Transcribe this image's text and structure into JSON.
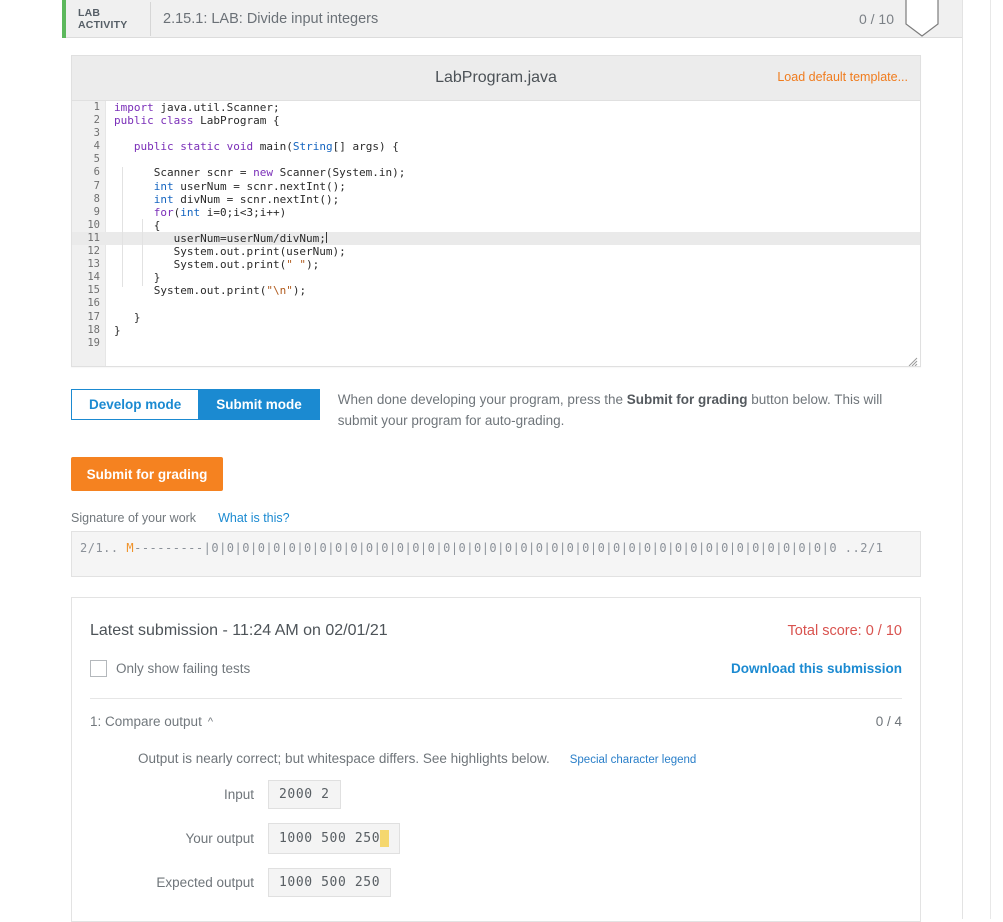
{
  "lab_header": {
    "tag_line1": "LAB",
    "tag_line2": "ACTIVITY",
    "title": "2.15.1: LAB: Divide input integers",
    "score": "0 / 10"
  },
  "editor": {
    "filename": "LabProgram.java",
    "load_default_label": "Load default template...",
    "highlight_line": 11,
    "lines": [
      {
        "no": "1",
        "code": "import java.util.Scanner;"
      },
      {
        "no": "2",
        "code": "public class LabProgram {"
      },
      {
        "no": "3",
        "code": ""
      },
      {
        "no": "4",
        "code": "   public static void main(String[] args) {"
      },
      {
        "no": "5",
        "code": ""
      },
      {
        "no": "6",
        "code": "      Scanner scnr = new Scanner(System.in);"
      },
      {
        "no": "7",
        "code": "      int userNum = scnr.nextInt();"
      },
      {
        "no": "8",
        "code": "      int divNum = scnr.nextInt();"
      },
      {
        "no": "9",
        "code": "      for(int i=0;i<3;i++)"
      },
      {
        "no": "10",
        "code": "      {"
      },
      {
        "no": "11",
        "code": "         userNum=userNum/divNum;"
      },
      {
        "no": "12",
        "code": "         System.out.print(userNum);"
      },
      {
        "no": "13",
        "code": "         System.out.print(\" \");"
      },
      {
        "no": "14",
        "code": "      }"
      },
      {
        "no": "15",
        "code": "      System.out.print(\"\\n\");"
      },
      {
        "no": "16",
        "code": ""
      },
      {
        "no": "17",
        "code": "   }"
      },
      {
        "no": "18",
        "code": "}"
      },
      {
        "no": "19",
        "code": ""
      }
    ]
  },
  "mode": {
    "develop_label": "Develop mode",
    "submit_label": "Submit mode",
    "note_prefix": "When done developing your program, press the ",
    "note_bold": "Submit for grading",
    "note_suffix": " button below. This will submit your program for auto-grading."
  },
  "submit_button": {
    "label": "Submit for grading"
  },
  "signature": {
    "label": "Signature of your work",
    "what_is_this": "What is this?",
    "prefix": "2/1.. ",
    "marker": "M",
    "dashes": "---------",
    "body": "|0|0|0|0|0|0|0|0|0|0|0|0|0|0|0|0|0|0|0|0|0|0|0|0|0|0|0|0|0|0|0|0|0|0|0|0|0|0|0|0|0",
    "suffix": " ..2/1"
  },
  "submission": {
    "title": "Latest submission - 11:24 AM on 02/01/21",
    "total_score": "Total score: 0 / 10",
    "only_failing_label": "Only show failing tests",
    "download_label": "Download this submission",
    "test": {
      "title": "1: Compare output",
      "chevron": "chevron-up-icon",
      "score": "0 / 4",
      "message": "Output is nearly correct; but whitespace differs. See highlights below.",
      "legend_link": "Special character legend",
      "rows": [
        {
          "label": "Input",
          "value": "2000 2",
          "trailing_ws": false
        },
        {
          "label": "Your output",
          "value": "1000 500 250",
          "trailing_ws": true
        },
        {
          "label": "Expected output",
          "value": "1000 500 250",
          "trailing_ws": false
        }
      ]
    }
  },
  "colors": {
    "accent_blue": "#1b8ad1",
    "accent_orange": "#f58220",
    "link_orange": "#f07c1e",
    "error_red": "#d9534f",
    "green_bar": "#5cb85c",
    "highlight_yellow": "#f5d76e"
  }
}
